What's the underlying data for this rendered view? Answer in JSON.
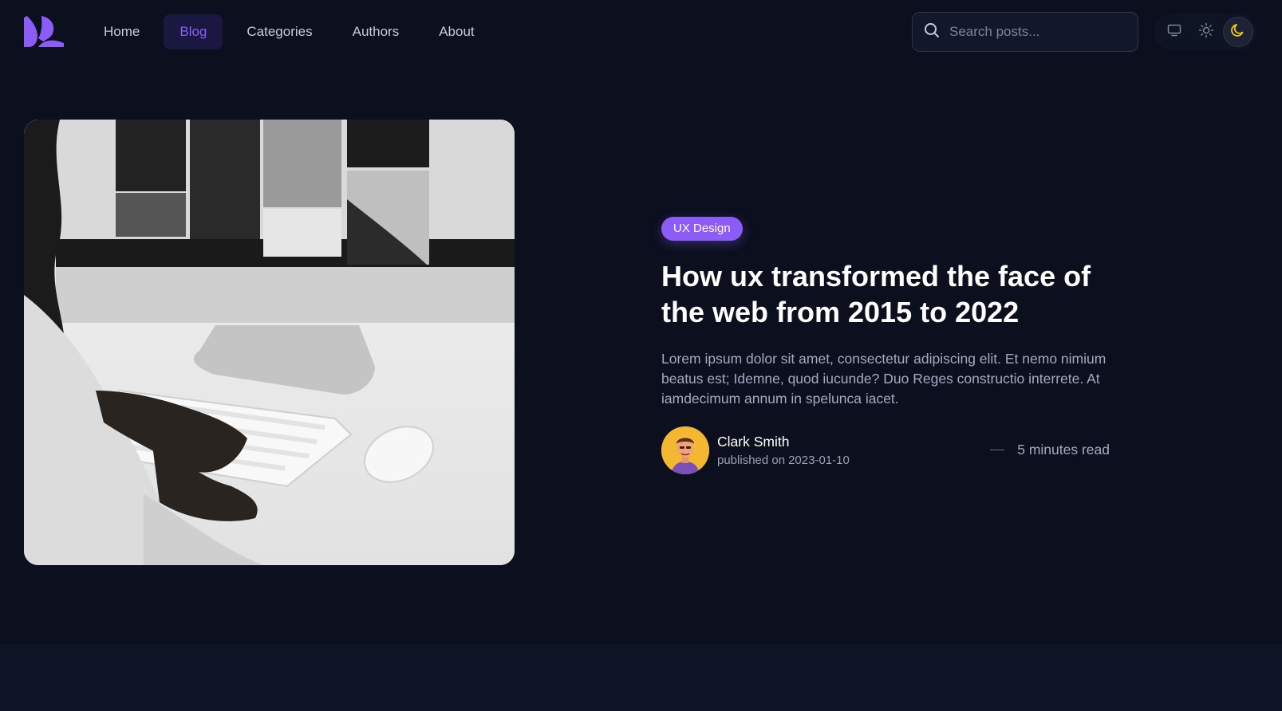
{
  "nav": {
    "logo": "logo-icon",
    "items": [
      {
        "label": "Home"
      },
      {
        "label": "Blog"
      },
      {
        "label": "Categories"
      },
      {
        "label": "Authors"
      },
      {
        "label": "About"
      }
    ],
    "active_item": "Blog"
  },
  "search": {
    "placeholder": "Search posts...",
    "value": "",
    "icon": "search-icon"
  },
  "theme_switch": {
    "options": [
      "system-monitor-icon",
      "sun-icon",
      "moon-icon"
    ],
    "selected": "moon-icon"
  },
  "post": {
    "image": "person-typing-at-desktop-computer-photo",
    "tag": "UX Design",
    "title": "How ux transformed the face of the web from 2015 to 2022",
    "excerpt": "Lorem ipsum dolor sit amet, consectetur adipiscing elit. Et nemo nimium beatus est; Idemne, quod iucunde? Duo Reges constructio interrete. At iamdecimum annum in spelunca iacet.",
    "author": {
      "name": "Clark Smith",
      "published_label": "published on",
      "date": "2023-01-10",
      "avatar": "avatar-illustration"
    },
    "read_time": "5 minutes read"
  },
  "colors": {
    "background": "#0b0f1e",
    "accent": "#8b5cf6",
    "moon": "#facc15"
  }
}
